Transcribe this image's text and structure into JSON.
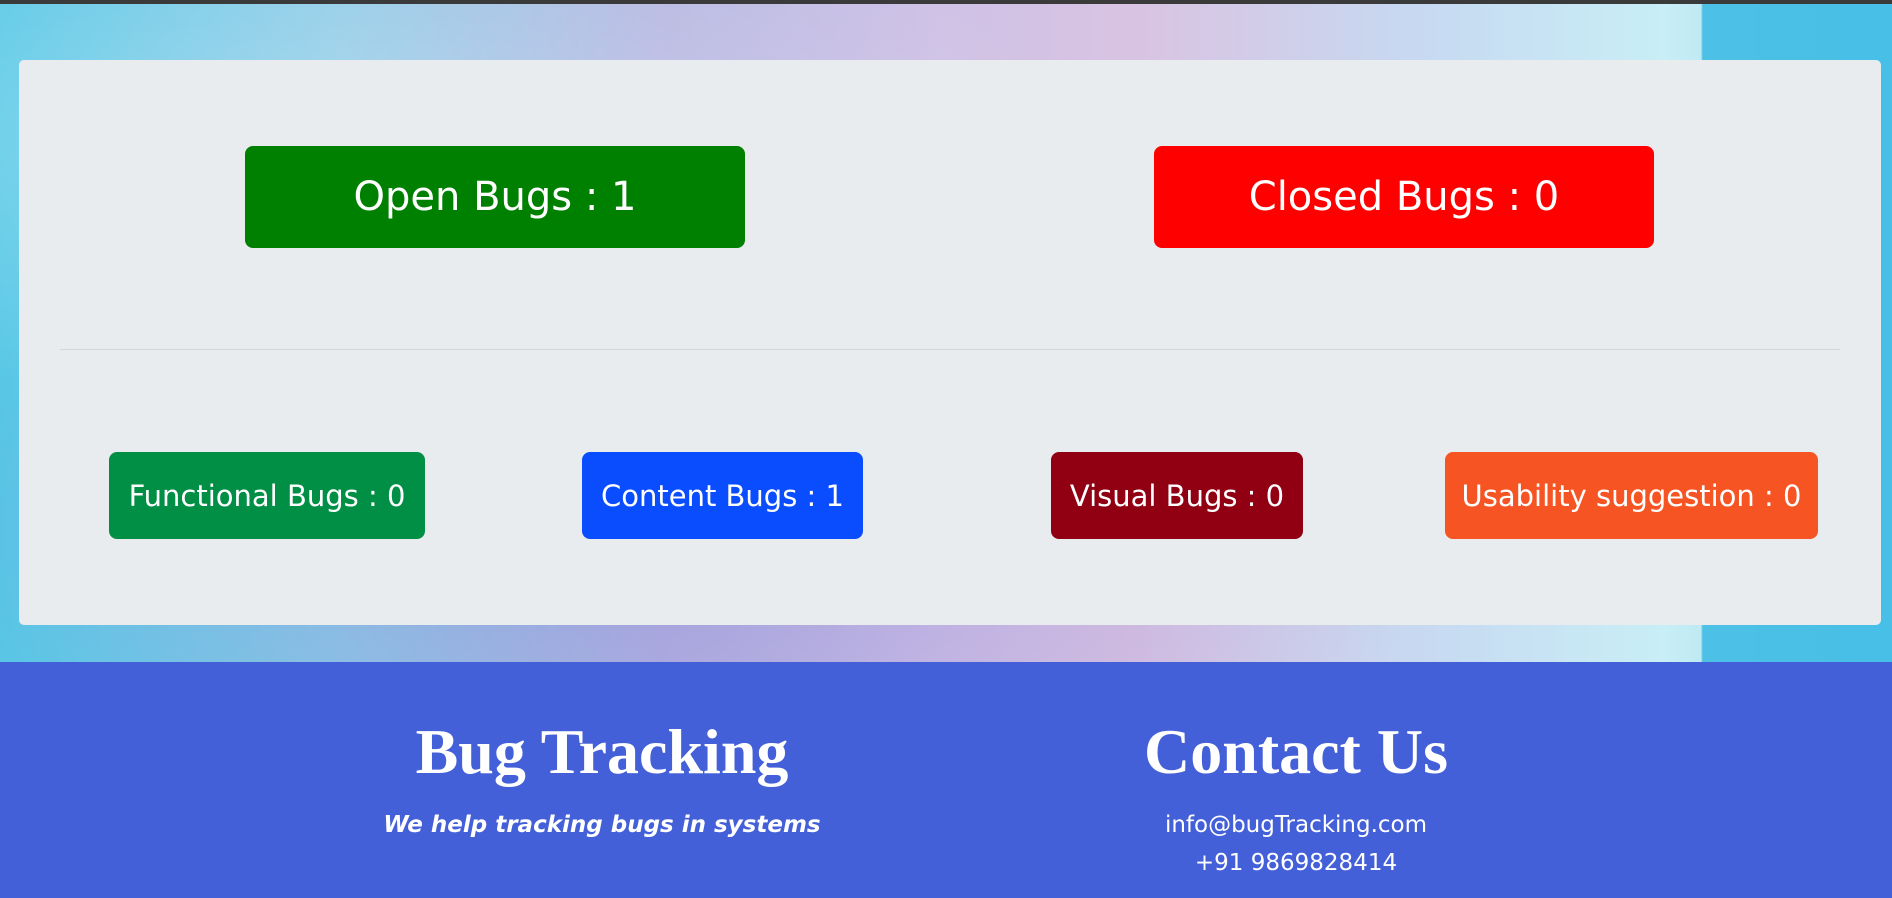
{
  "summary": {
    "open_bugs": "Open Bugs : 1",
    "closed_bugs": "Closed Bugs : 0"
  },
  "categories": {
    "functional": "Functional Bugs : 0",
    "content": "Content Bugs : 1",
    "visual": "Visual Bugs : 0",
    "usability": "Usability suggestion : 0"
  },
  "footer": {
    "brand_title": "Bug Tracking",
    "tagline": "We help tracking bugs in systems",
    "contact_title": "Contact Us",
    "email": "info@bugTracking.com",
    "phone": "+91 9869828414"
  },
  "colors": {
    "open": "#008000",
    "closed": "#ff0000",
    "functional": "#008f45",
    "content": "#0a4dff",
    "visual": "#900012",
    "usability": "#f65422",
    "footer_bg": "#4460d8",
    "card_bg": "#e9ecef"
  }
}
